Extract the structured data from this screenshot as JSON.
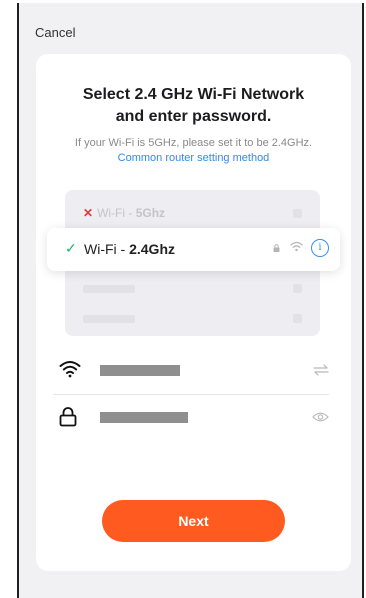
{
  "header": {
    "cancel_label": "Cancel"
  },
  "card": {
    "title_line1": "Select 2.4 GHz Wi-Fi Network",
    "title_line2": "and enter password.",
    "subtitle_text": "If your Wi-Fi is 5GHz, please set it to be 2.4GHz.",
    "subtitle_link": "Common router setting method"
  },
  "networks": {
    "unsupported": {
      "prefix": "Wi-Fi - ",
      "band": "5Ghz",
      "status_icon": "x-icon",
      "status_color": "#e5383b"
    },
    "selected": {
      "prefix": "Wi-Fi - ",
      "band": "2.4Ghz",
      "status_icon": "check-icon",
      "status_color": "#19b56f",
      "info_glyph": "i"
    }
  },
  "form": {
    "wifi_field_icon": "wifi-icon",
    "wifi_action_icon": "switch-network-icon",
    "password_field_icon": "lock-icon",
    "password_action_icon": "eye-icon"
  },
  "actions": {
    "next_label": "Next"
  },
  "colors": {
    "accent": "#ff5a1f",
    "link": "#2b8cf0",
    "success": "#19b56f",
    "error": "#e5383b"
  }
}
